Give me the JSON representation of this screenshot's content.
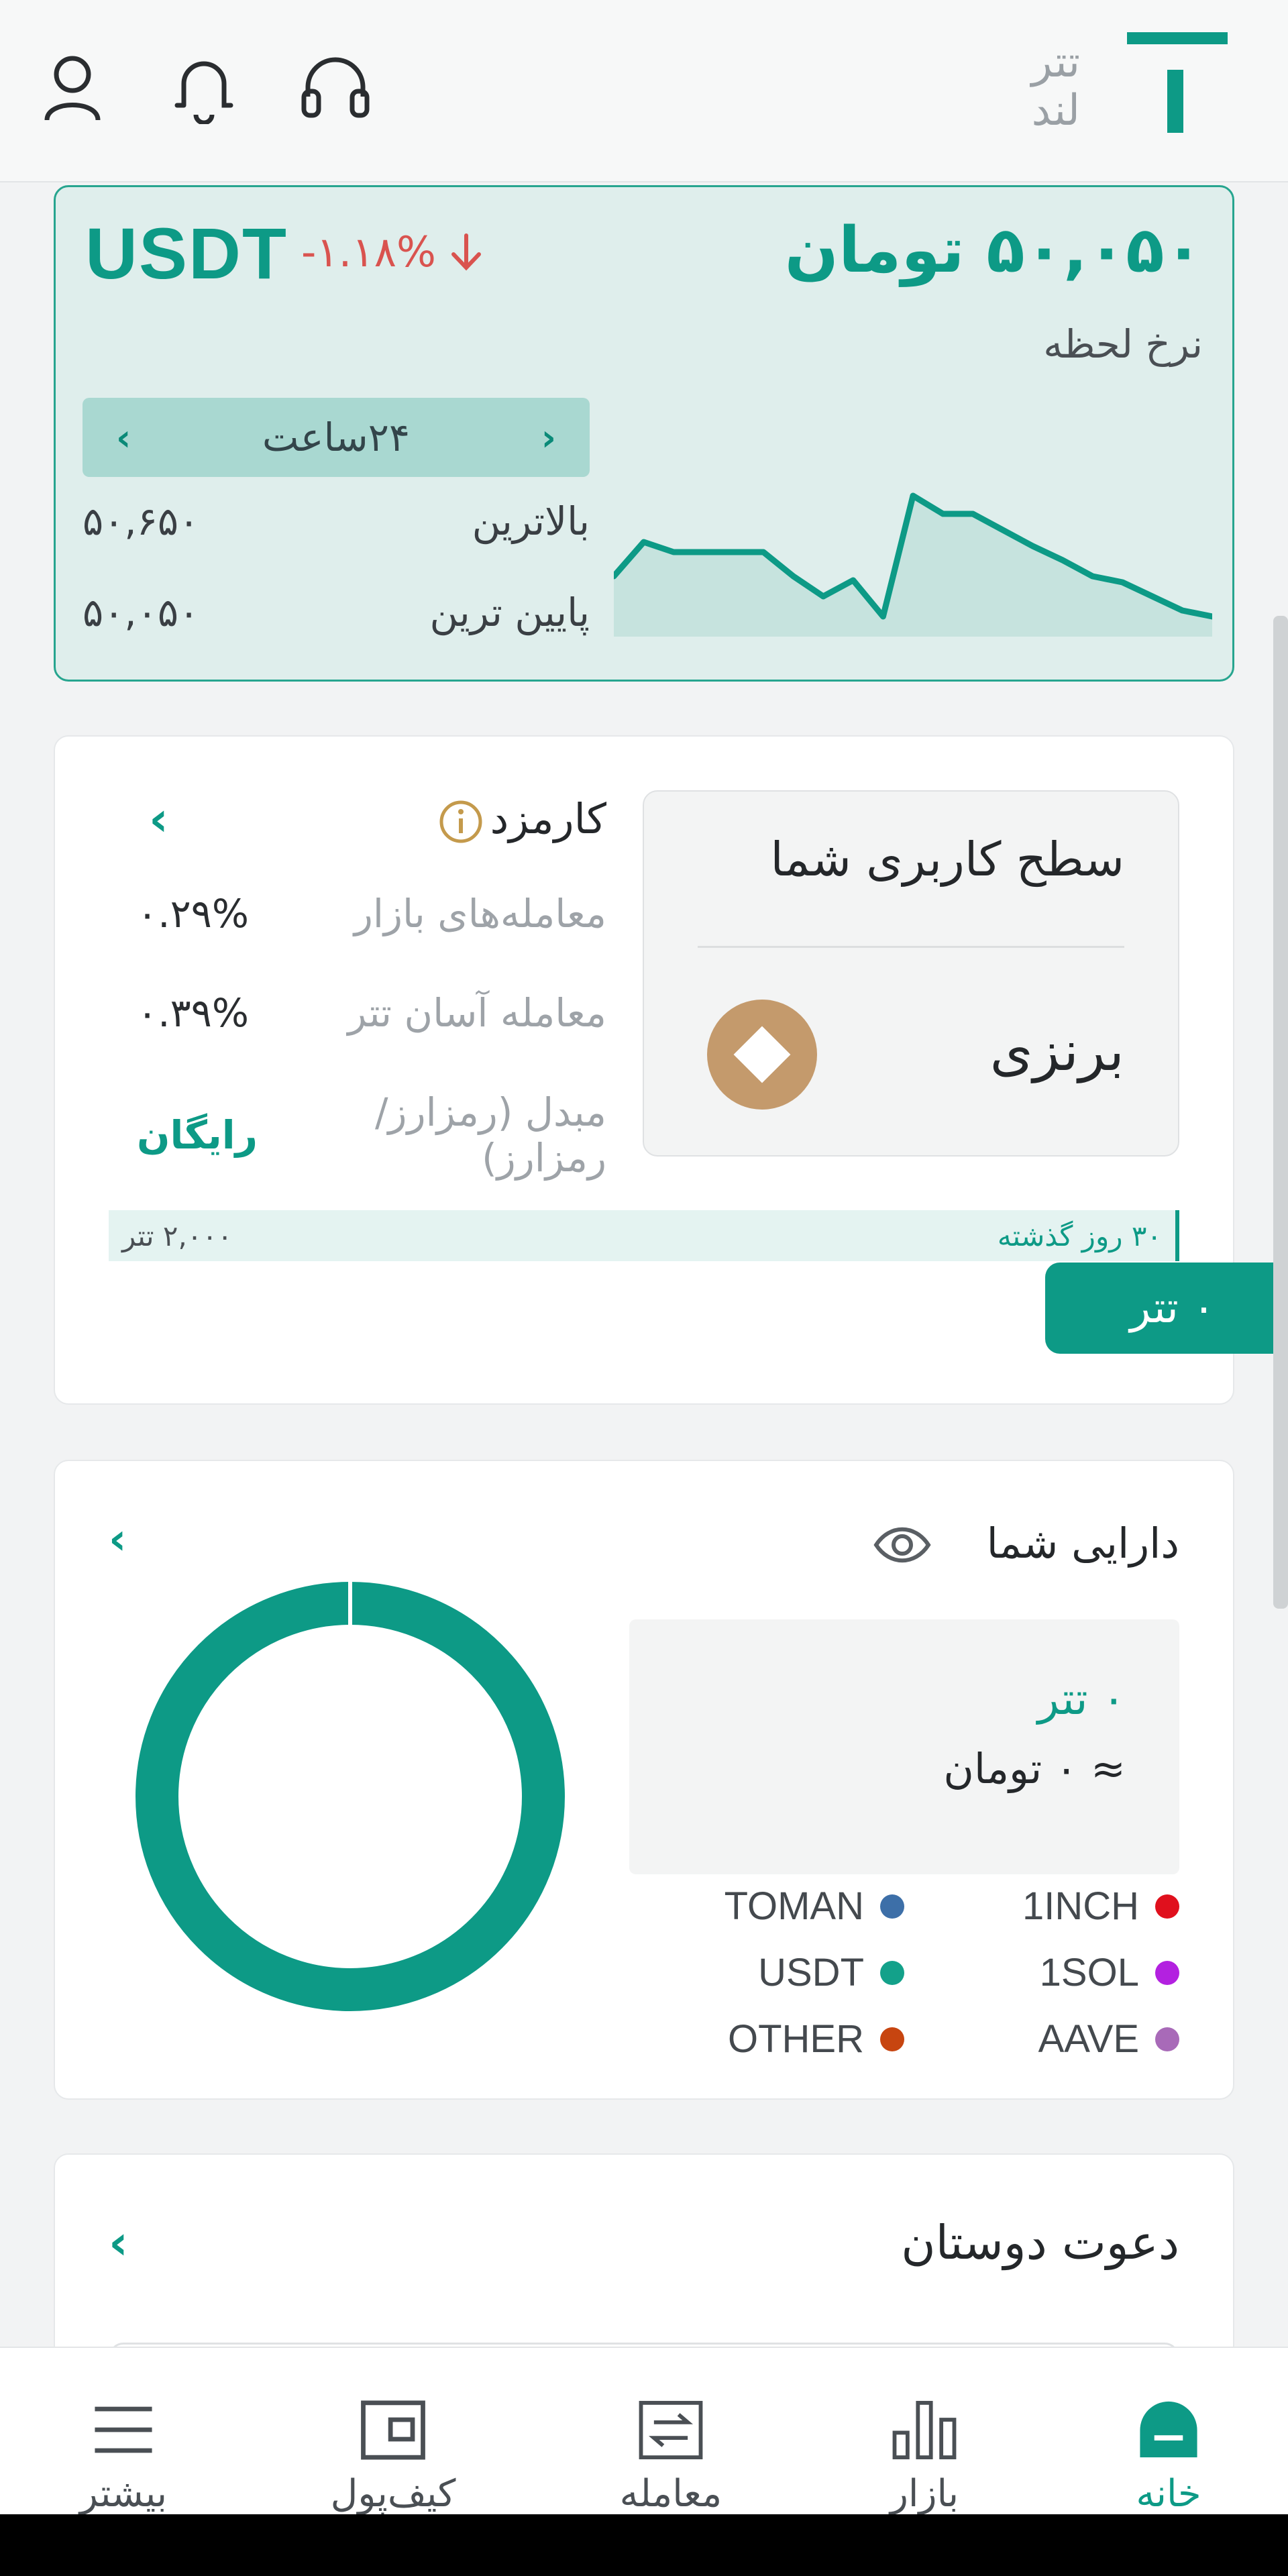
{
  "header": {
    "logo_text_line1": "تتر",
    "logo_text_line2": "لند"
  },
  "rate_card": {
    "symbol": "USDT",
    "change": "-۱.۱۸%",
    "price": "۵۰,۰۵۰ تومان",
    "subtitle": "نرخ لحظه",
    "period": "۲۴ساعت",
    "high_label": "بالاترین",
    "high_value": "۵۰,۶۵۰",
    "low_label": "پایین ترین",
    "low_value": "۵۰,۰۵۰",
    "sparkline": [
      50250,
      50420,
      50370,
      50370,
      50370,
      50370,
      50250,
      50150,
      50230,
      50050,
      50650,
      50560,
      50560,
      50480,
      50400,
      50330,
      50250,
      50220,
      50150,
      50080,
      50050
    ]
  },
  "fee_card": {
    "level_title": "سطح کاربری شما",
    "level_name": "برنزی",
    "fee_title": "کارمزد",
    "rows": [
      {
        "label": "معامله‌های بازار",
        "value": "۰.۲۹%"
      },
      {
        "label": "معامله آسان تتر",
        "value": "۰.۳۹%"
      },
      {
        "label": "مبدل (رمزارز/رمزارز)",
        "value": "رایگان"
      }
    ],
    "progress_left": "۲,۰۰۰ تتر",
    "progress_right": "۳۰ روز گذشته",
    "progress_fraction": 0,
    "balance": "۰ تتر"
  },
  "asset_card": {
    "title": "دارایی شما",
    "usdt": "۰ تتر",
    "toman": "≈ ۰ تومان",
    "donut_fraction_usdt": 1,
    "legend": [
      {
        "name": "1INCH",
        "color": "#e0101d"
      },
      {
        "name": "TOMAN",
        "color": "#3d6fa8"
      },
      {
        "name": "1SOL",
        "color": "#b321e0"
      },
      {
        "name": "USDT",
        "color": "#13a18a"
      },
      {
        "name": "AAVE",
        "color": "#a86ab8"
      },
      {
        "name": "OTHER",
        "color": "#c74510"
      }
    ]
  },
  "invite_card": {
    "title": "دعوت دوستان"
  },
  "nav": {
    "items": [
      "خانه",
      "بازار",
      "معامله",
      "کیف‌پول",
      "بیشتر"
    ],
    "active": "خانه"
  },
  "colors": {
    "accent": "#0d9a86",
    "negative": "#d9534f",
    "bronze": "#c49a6c"
  }
}
